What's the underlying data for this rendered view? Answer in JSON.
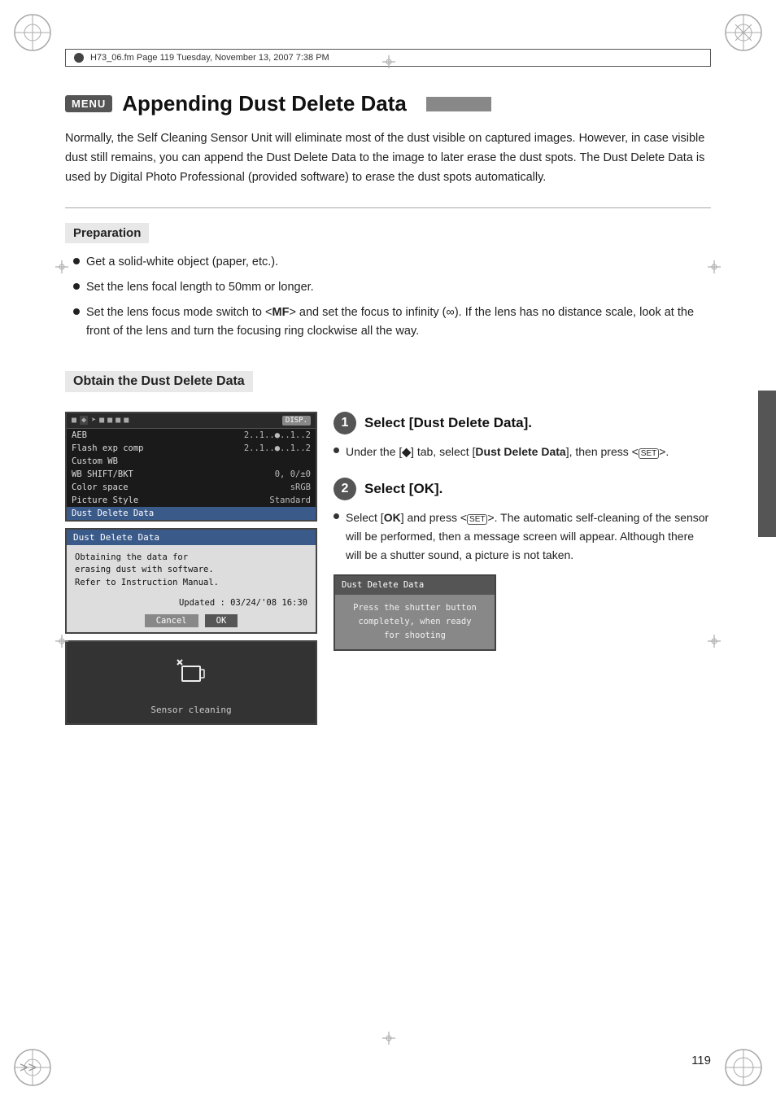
{
  "page": {
    "header_text": "H73_06.fm  Page 119  Tuesday, November 13, 2007  7:38 PM",
    "page_number": "119",
    "section_title": "Appending Dust Delete Data",
    "menu_label": "MENU",
    "title_bar_exists": true,
    "intro_text": "Normally, the Self Cleaning Sensor Unit will eliminate most of the dust visible on captured images. However, in case visible dust still remains, you can append the Dust Delete Data to the image to later erase the dust spots. The Dust Delete Data is used by Digital Photo Professional (provided software) to erase the dust spots automatically.",
    "preparation": {
      "heading": "Preparation",
      "bullets": [
        "Get a solid-white object (paper, etc.).",
        "Set the lens focal length to 50mm or longer.",
        "Set the lens focus mode switch to <MF> and set the focus to infinity (∞). If the lens has no distance scale, look at the front of the lens and turn the focusing ring clockwise all the way."
      ]
    },
    "obtain_section": {
      "heading": "Obtain the Dust Delete Data",
      "camera_menu": {
        "tabs": "■ ◆ ➤ ■ ■ ■ ■",
        "disp": "DISP.",
        "rows": [
          {
            "label": "AEB",
            "value": "2..1..●..1..2",
            "selected": false
          },
          {
            "label": "Flash exp comp",
            "value": "2..1..●..1..2",
            "selected": false
          },
          {
            "label": "Custom WB",
            "value": "",
            "selected": false
          },
          {
            "label": "WB SHIFT/BKT",
            "value": "0, 0/±0",
            "selected": false
          },
          {
            "label": "Color space",
            "value": "sRGB",
            "selected": false
          },
          {
            "label": "Picture Style",
            "value": "Standard",
            "selected": false
          },
          {
            "label": "Dust Delete Data",
            "value": "",
            "selected": true
          }
        ]
      },
      "dialog": {
        "title": "Dust Delete Data",
        "body_line1": "Obtaining the data for",
        "body_line2": "erasing dust with software.",
        "body_line3": "Refer to Instruction Manual.",
        "updated_label": "Updated :",
        "updated_value": "03/24/'08 16:30",
        "cancel_label": "Cancel",
        "ok_label": "OK"
      },
      "sensor_screen": {
        "label": "Sensor cleaning"
      }
    },
    "steps": [
      {
        "number": "1",
        "title": "Select [Dust Delete Data].",
        "bullets": [
          "Under the [◆] tab, select [Dust Delete Data], then press <(SET)>."
        ]
      },
      {
        "number": "2",
        "title": "Select [OK].",
        "body": "Select [OK] and press <(SET)>. The automatic self-cleaning of the sensor will be performed, then a message screen will appear. Although there will be a shutter sound, a picture is not taken.",
        "dialog": {
          "title": "Dust Delete Data",
          "line1": "Press the shutter button",
          "line2": "completely, when ready",
          "line3": "for shooting"
        }
      }
    ]
  }
}
